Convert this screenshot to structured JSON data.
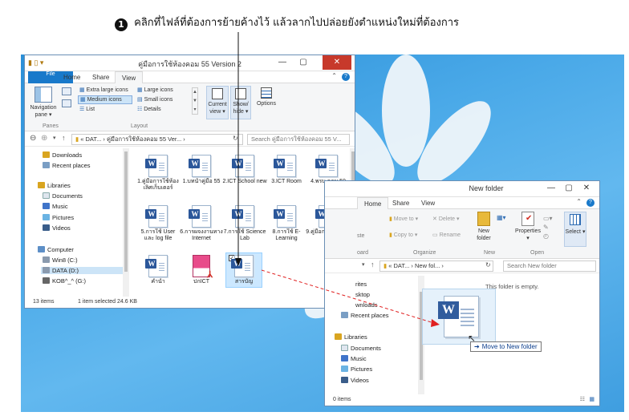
{
  "instruction": {
    "number": "1",
    "text": "คลิกที่ไฟล์ที่ต้องการย้ายค้างไว้ แล้วลากไปปล่อยยังตำแหน่งใหม่ที่ต้องการ"
  },
  "win1": {
    "title": "คู่มือการใช้ห้องคอม 55 Version 2",
    "menus": [
      "File",
      "Home",
      "Share",
      "View"
    ],
    "ribbon": {
      "nav_pane": "Navigation pane",
      "panes": "Panes",
      "layout_items": [
        "Extra large icons",
        "Large icons",
        "Medium icons",
        "Small icons",
        "List",
        "Details"
      ],
      "layout": "Layout",
      "current_view": "Current view",
      "show_hide": "Show/ hide",
      "options": "Options"
    },
    "address": "«  DAT...  ›  คู่มือการใช้ห้องคอม 55 Ver...  ›",
    "search_placeholder": "Search คู่มือการใช้ห้องคอม 55 V...",
    "nav_items": [
      "Downloads",
      "Recent places",
      "Libraries",
      "Documents",
      "Music",
      "Pictures",
      "Videos",
      "Computer",
      "Win8 (C:)",
      "DATA (D:)",
      "KOB^_^ (G:)"
    ],
    "files": [
      "1.คู่มือการใช้ห้องเลิศเก็บเตอร์",
      "1.บทนำคู่มือ 55",
      "2.ICT School new",
      "3.ICT Room",
      "4.พรบ.คอม 50",
      "5.การใช้ User และ log file",
      "6.การผจงงานทาง Internet",
      "7.การใช้ Science Lab",
      "8.การใช้ E-Learning",
      "9.คู่มือการใช้ iPad",
      "คำนำ",
      "ปกICT",
      "สารบัญ"
    ],
    "status_count": "13 items",
    "status_selected": "1 item selected  24.6 KB"
  },
  "win2": {
    "title": "New folder",
    "menus": [
      "Home",
      "Share",
      "View"
    ],
    "ribbon": {
      "move_to": "Move to",
      "copy_to": "Copy to",
      "delete": "Delete",
      "rename": "Rename",
      "new_folder": "New folder",
      "properties": "Properties",
      "select": "Select",
      "organize": "Organize",
      "new": "New",
      "open": "Open",
      "board": "oard",
      "ste": "ste"
    },
    "address": "«  DAT...  ›  New fol...  ›",
    "search_placeholder": "Search New folder",
    "empty_text": "This folder is empty.",
    "nav_items": [
      "rites",
      "sktop",
      "wnloads",
      "Recent places",
      "Libraries",
      "Documents",
      "Music",
      "Pictures",
      "Videos"
    ],
    "status_count": "0 items"
  },
  "drag_tip": "Move to New folder",
  "colors": {
    "accent": "#1979ca",
    "close": "#c7392b",
    "drag_line": "#e02020",
    "word": "#2b579a"
  }
}
